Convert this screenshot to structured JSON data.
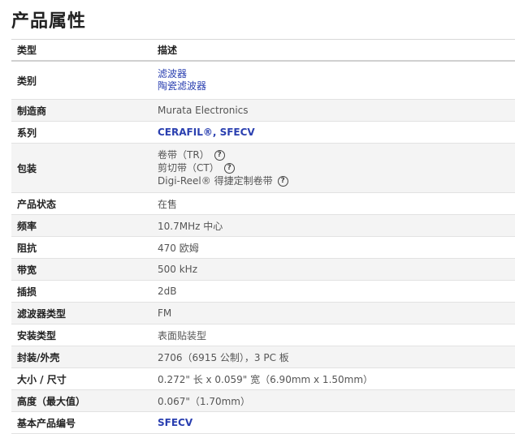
{
  "page_title": "产品属性",
  "headers": {
    "type": "类型",
    "desc": "描述"
  },
  "category": {
    "label": "类别",
    "values": [
      "滤波器",
      "陶瓷滤波器"
    ]
  },
  "manufacturer": {
    "label": "制造商",
    "value": "Murata Electronics"
  },
  "series": {
    "label": "系列",
    "value": "CERAFIL®, SFECV"
  },
  "packaging": {
    "label": "包装",
    "values": [
      "卷带（TR）",
      "剪切带（CT）",
      "Digi-Reel® 得捷定制卷带"
    ],
    "help_glyph": "?"
  },
  "status": {
    "label": "产品状态",
    "value": "在售"
  },
  "frequency": {
    "label": "频率",
    "value": "10.7MHz 中心"
  },
  "impedance": {
    "label": "阻抗",
    "value": "470 欧姆"
  },
  "bandwidth": {
    "label": "带宽",
    "value": "500 kHz"
  },
  "insertion_loss": {
    "label": "插损",
    "value": "2dB"
  },
  "filter_type": {
    "label": "滤波器类型",
    "value": "FM"
  },
  "mount_type": {
    "label": "安装类型",
    "value": "表面贴装型"
  },
  "package_case": {
    "label": "封装/外壳",
    "value": "2706（6915 公制），3 PC 板"
  },
  "size": {
    "label": "大小 / 尺寸",
    "value": "0.272\" 长 x 0.059\" 宽（6.90mm x 1.50mm）"
  },
  "height": {
    "label": "高度（最大值）",
    "value": "0.067\"（1.70mm）"
  },
  "base_part": {
    "label": "基本产品编号",
    "value": "SFECV"
  }
}
